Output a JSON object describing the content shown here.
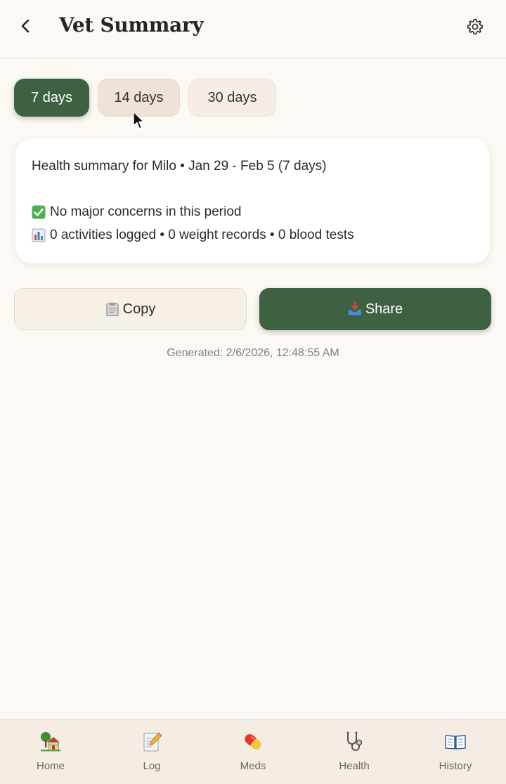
{
  "header": {
    "title": "Vet Summary",
    "back_icon": "chevron-left-icon",
    "settings_icon": "gear-icon"
  },
  "range_tabs": [
    {
      "label": "7 days",
      "state": "selected"
    },
    {
      "label": "14 days",
      "state": "hover"
    },
    {
      "label": "30 days",
      "state": "default"
    }
  ],
  "summary": {
    "header": "Health summary for Milo • Jan 29 - Feb 5 (7 days)",
    "status": "No major concerns in this period",
    "status_icon": "check-mark-icon",
    "stats": "0 activities logged • 0 weight records • 0 blood tests",
    "stats_icon": "bar-chart-icon"
  },
  "actions": {
    "copy_label": "Copy",
    "copy_icon": "clipboard-icon",
    "share_label": "Share",
    "share_icon": "inbox-tray-icon"
  },
  "generated": "Generated: 2/6/2026, 12:48:55 AM",
  "nav": [
    {
      "label": "Home",
      "icon": "house-with-garden-icon"
    },
    {
      "label": "Log",
      "icon": "memo-icon"
    },
    {
      "label": "Meds",
      "icon": "pill-icon"
    },
    {
      "label": "Health",
      "icon": "stethoscope-icon"
    },
    {
      "label": "History",
      "icon": "open-book-icon"
    }
  ],
  "colors": {
    "background": "#fcf8f3",
    "accent_green": "#3e6142",
    "card": "#ffffff",
    "nav_background": "#f5ede3"
  }
}
